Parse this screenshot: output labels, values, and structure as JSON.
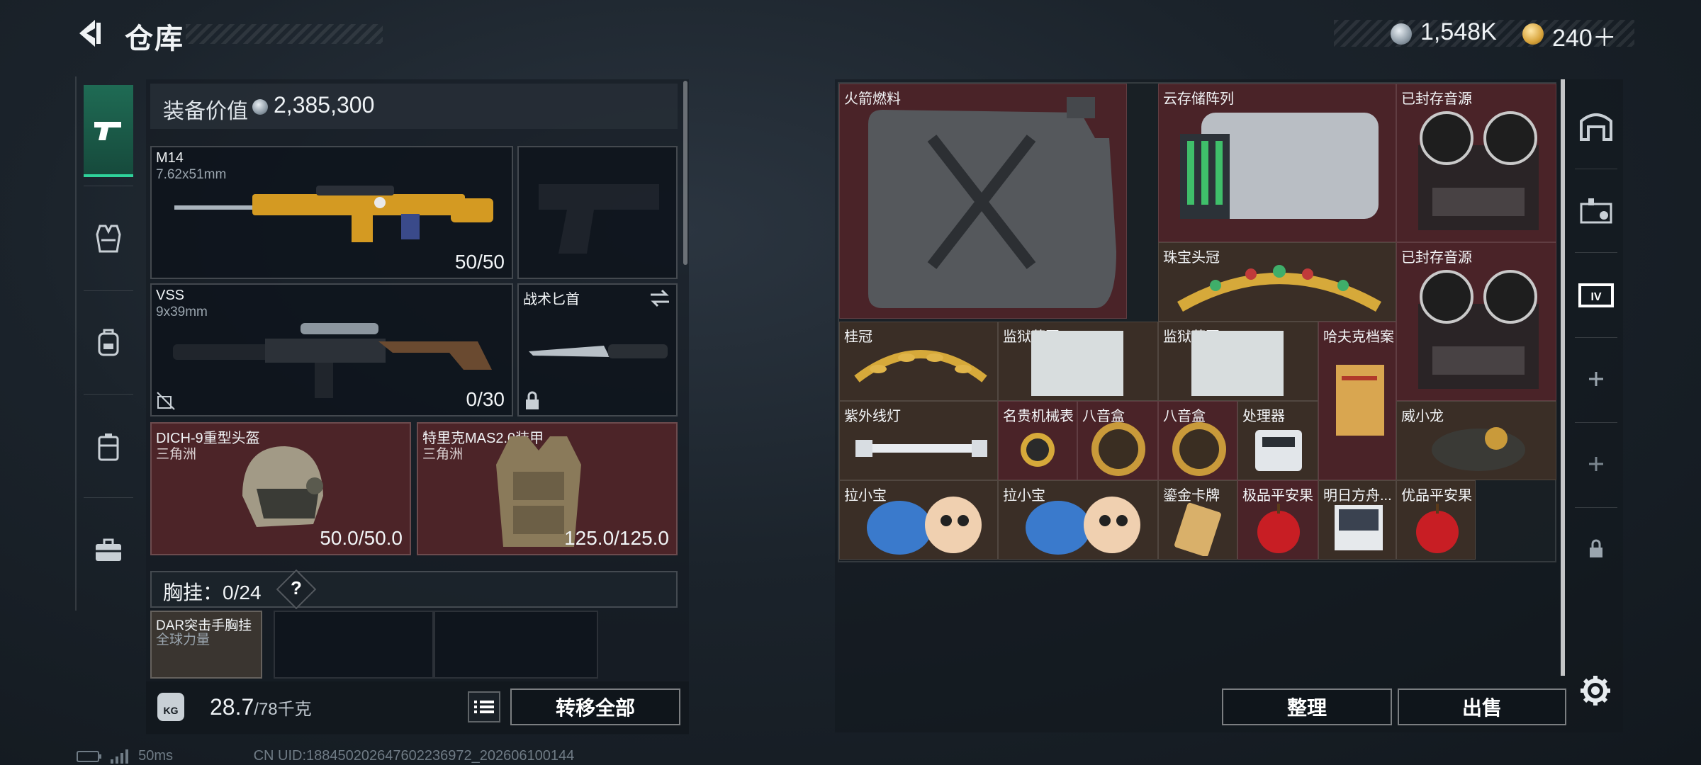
{
  "header": {
    "title": "仓库"
  },
  "currency": {
    "silver": "1,548K",
    "gold": "240＋"
  },
  "equipment": {
    "value_label": "装备价值",
    "value": "2,385,300",
    "primary": {
      "name": "M14",
      "caliber": "7.62x51mm",
      "ammo": "50/50"
    },
    "secondary": {
      "name": "VSS",
      "caliber": "9x39mm",
      "ammo": "0/30"
    },
    "melee": {
      "name": "战术匕首"
    },
    "helmet": {
      "name": "DICH-9重型头盔",
      "origin": "三角洲",
      "durability": "50.0/50.0"
    },
    "armor": {
      "name": "特里克MAS2.0装甲",
      "origin": "三角洲",
      "durability": "125.0/125.0"
    },
    "chest_rig": {
      "label": "胸挂：",
      "count": "0/24",
      "help": "?",
      "name": "DAR突击手胸挂",
      "origin": "全球力量"
    }
  },
  "footer": {
    "weight": "28.7",
    "weight_max": "/78千克",
    "transfer_all": "转移全部",
    "organize": "整理",
    "sell": "出售"
  },
  "status": {
    "ping": "50ms",
    "uid": "CN UID:18845020264760223697​2_202606100144"
  },
  "stash_items": [
    {
      "name": "火箭燃料"
    },
    {
      "name": "云存储阵列"
    },
    {
      "name": "已封存音源"
    },
    {
      "name": "珠宝头冠"
    },
    {
      "name": "已封存音源"
    },
    {
      "name": "桂冠"
    },
    {
      "name": "监狱蓝图1"
    },
    {
      "name": "监狱蓝图1"
    },
    {
      "name": "哈夫克档案"
    },
    {
      "name": "紫外线灯"
    },
    {
      "name": "名贵机械表"
    },
    {
      "name": "八音盒"
    },
    {
      "name": "八音盒"
    },
    {
      "name": "处理器"
    },
    {
      "name": "威小龙"
    },
    {
      "name": "拉小宝"
    },
    {
      "name": "拉小宝"
    },
    {
      "name": "鎏金卡牌"
    },
    {
      "name": "极品平安果"
    },
    {
      "name": "明日方舟..."
    },
    {
      "name": "优品平安果"
    }
  ],
  "colors": {
    "active_tab": "#1f6b54",
    "accent": "#2fd29a",
    "rare_bg": "#4a2328",
    "gold_bg": "#3a2e26"
  }
}
